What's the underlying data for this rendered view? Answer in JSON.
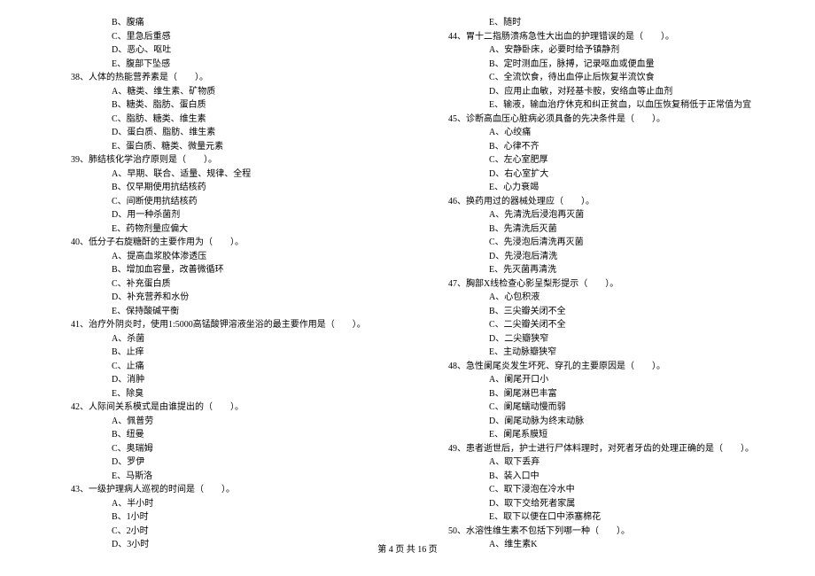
{
  "footer": "第 4 页  共 16 页",
  "left_column": [
    {
      "type": "option",
      "text": "B、腹痛"
    },
    {
      "type": "option",
      "text": "C、里急后重感"
    },
    {
      "type": "option",
      "text": "D、恶心、呕吐"
    },
    {
      "type": "option",
      "text": "E、腹部下坠感"
    },
    {
      "type": "question",
      "text": "38、人体的热能营养素是（　　）。"
    },
    {
      "type": "option",
      "text": "A、糖类、维生素、矿物质"
    },
    {
      "type": "option",
      "text": "B、糖类、脂肪、蛋白质"
    },
    {
      "type": "option",
      "text": "C、脂肪、糖类、维生素"
    },
    {
      "type": "option",
      "text": "D、蛋白质、脂肪、维生素"
    },
    {
      "type": "option",
      "text": "E、蛋白质、糖类、微量元素"
    },
    {
      "type": "question",
      "text": "39、肺结核化学治疗原则是（　　）。"
    },
    {
      "type": "option",
      "text": "A、早期、联合、适量、规律、全程"
    },
    {
      "type": "option",
      "text": "B、仅早期使用抗结核药"
    },
    {
      "type": "option",
      "text": "C、间断使用抗结核药"
    },
    {
      "type": "option",
      "text": "D、用一种杀菌剂"
    },
    {
      "type": "option",
      "text": "E、药物剂量应偏大"
    },
    {
      "type": "question",
      "text": "40、低分子右旋糖酐的主要作用为（　　）。"
    },
    {
      "type": "option",
      "text": "A、提高血浆胶体渗透压"
    },
    {
      "type": "option",
      "text": "B、增加血容量，改善微循环"
    },
    {
      "type": "option",
      "text": "C、补充蛋白质"
    },
    {
      "type": "option",
      "text": "D、补充营养和水份"
    },
    {
      "type": "option",
      "text": "E、保持酸碱平衡"
    },
    {
      "type": "question",
      "text": "41、治疗外阴炎时，使用1:5000高锰酸钾溶液坐浴的最主要作用是（　　）。"
    },
    {
      "type": "option",
      "text": "A、杀菌"
    },
    {
      "type": "option",
      "text": "B、止痒"
    },
    {
      "type": "option",
      "text": "C、止痛"
    },
    {
      "type": "option",
      "text": "D、消肿"
    },
    {
      "type": "option",
      "text": "E、除臭"
    },
    {
      "type": "question",
      "text": "42、人际间关系模式是由谁提出的（　　）。"
    },
    {
      "type": "option",
      "text": "A、佩普劳"
    },
    {
      "type": "option",
      "text": "B、纽曼"
    },
    {
      "type": "option",
      "text": "C、奥瑞姆"
    },
    {
      "type": "option",
      "text": "D、罗伊"
    },
    {
      "type": "option",
      "text": "E、马斯洛"
    },
    {
      "type": "question",
      "text": "43、一级护理病人巡视的时间是（　　）。"
    },
    {
      "type": "option",
      "text": "A、半小时"
    },
    {
      "type": "option",
      "text": "B、1小时"
    },
    {
      "type": "option",
      "text": "C、2小时"
    },
    {
      "type": "option",
      "text": "D、3小时"
    }
  ],
  "right_column": [
    {
      "type": "option",
      "text": "E、随时"
    },
    {
      "type": "question",
      "text": "44、胃十二指肠溃疡急性大出血的护理错误的是（　　）。"
    },
    {
      "type": "option",
      "text": "A、安静卧床，必要时给予镇静剂"
    },
    {
      "type": "option",
      "text": "B、定时测血压，脉搏，记录呕血或便血量"
    },
    {
      "type": "option",
      "text": "C、全流饮食，待出血停止后恢复半流饮食"
    },
    {
      "type": "option",
      "text": "D、应用止血敏，对羟基卡胺，安络血等止血剂"
    },
    {
      "type": "option",
      "text": "E、输液，输血治疗休克和纠正贫血，以血压恢复稍低于正常值为宜"
    },
    {
      "type": "question",
      "text": "45、诊断高血压心脏病必须具备的先决条件是（　　）。"
    },
    {
      "type": "option",
      "text": "A、心绞痛"
    },
    {
      "type": "option",
      "text": "B、心律不齐"
    },
    {
      "type": "option",
      "text": "C、左心室肥厚"
    },
    {
      "type": "option",
      "text": "D、右心室扩大"
    },
    {
      "type": "option",
      "text": "E、心力衰竭"
    },
    {
      "type": "question",
      "text": "46、换药用过的器械处理应（　　）。"
    },
    {
      "type": "option",
      "text": "A、先清洗后浸泡再灭菌"
    },
    {
      "type": "option",
      "text": "B、先清洗后灭菌"
    },
    {
      "type": "option",
      "text": "C、先浸泡后清洗再灭菌"
    },
    {
      "type": "option",
      "text": "D、先浸泡后清洗"
    },
    {
      "type": "option",
      "text": "E、先灭菌再清洗"
    },
    {
      "type": "question",
      "text": "47、胸部X线检查心影呈梨形提示（　　）。"
    },
    {
      "type": "option",
      "text": "A、心包积液"
    },
    {
      "type": "option",
      "text": "B、三尖瓣关闭不全"
    },
    {
      "type": "option",
      "text": "C、二尖瓣关闭不全"
    },
    {
      "type": "option",
      "text": "D、二尖瓣狭窄"
    },
    {
      "type": "option",
      "text": "E、主动脉瓣狭窄"
    },
    {
      "type": "question",
      "text": "48、急性阑尾炎发生坏死、穿孔的主要原因是（　　）。"
    },
    {
      "type": "option",
      "text": "A、阑尾开口小"
    },
    {
      "type": "option",
      "text": "B、阑尾淋巴丰富"
    },
    {
      "type": "option",
      "text": "C、阑尾蠕动慢而弱"
    },
    {
      "type": "option",
      "text": "D、阑尾动脉为终末动脉"
    },
    {
      "type": "option",
      "text": "E、阑尾系膜短"
    },
    {
      "type": "question",
      "text": "49、患者逝世后，护士进行尸体料理时，对死者牙齿的处理正确的是（　　）。"
    },
    {
      "type": "option",
      "text": "A、取下丢弃"
    },
    {
      "type": "option",
      "text": "B、装入口中"
    },
    {
      "type": "option",
      "text": "C、取下浸泡在冷水中"
    },
    {
      "type": "option",
      "text": "D、取下交给死者家属"
    },
    {
      "type": "option",
      "text": "E、取下以便在口中添塞棉花"
    },
    {
      "type": "question",
      "text": "50、水溶性维生素不包括下列哪一种（　　）。"
    },
    {
      "type": "option",
      "text": "A、维生素K"
    }
  ]
}
